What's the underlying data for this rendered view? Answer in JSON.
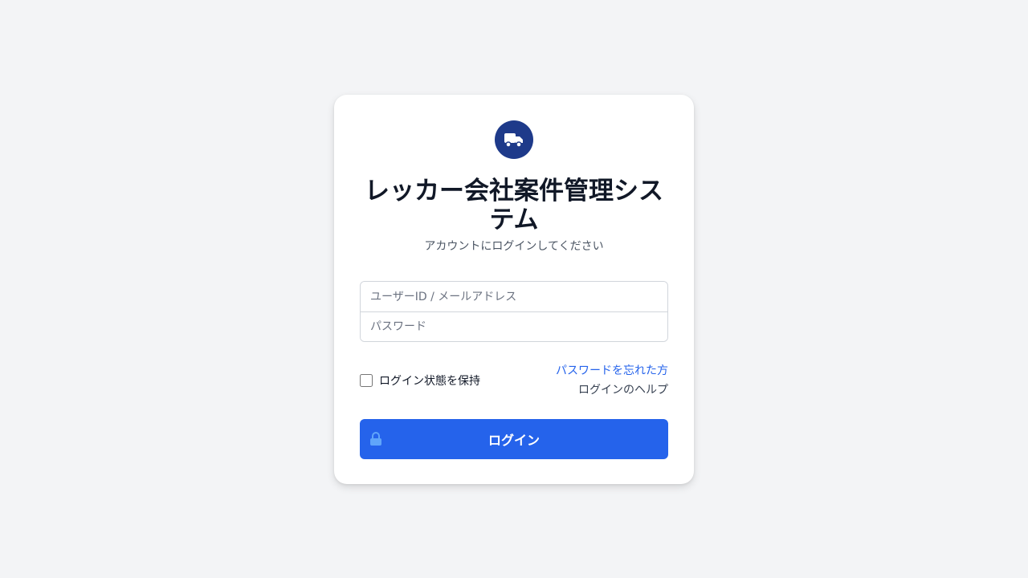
{
  "app": {
    "logo_icon": "truck-icon",
    "title": "レッカー会社案件管理システム",
    "subtitle": "アカウントにログインしてください"
  },
  "form": {
    "username_placeholder": "ユーザーID / メールアドレス",
    "username_value": "",
    "password_placeholder": "パスワード",
    "password_value": "",
    "remember_label": "ログイン状態を保持",
    "remember_checked": false,
    "forgot_link": "パスワードを忘れた方",
    "help_link": "ログインのヘルプ",
    "submit_label": "ログイン",
    "submit_icon": "lock-icon"
  },
  "colors": {
    "background": "#f3f4f6",
    "logo_bg": "#1e3a8a",
    "primary": "#2563eb",
    "link": "#2563eb",
    "title": "#111827"
  }
}
